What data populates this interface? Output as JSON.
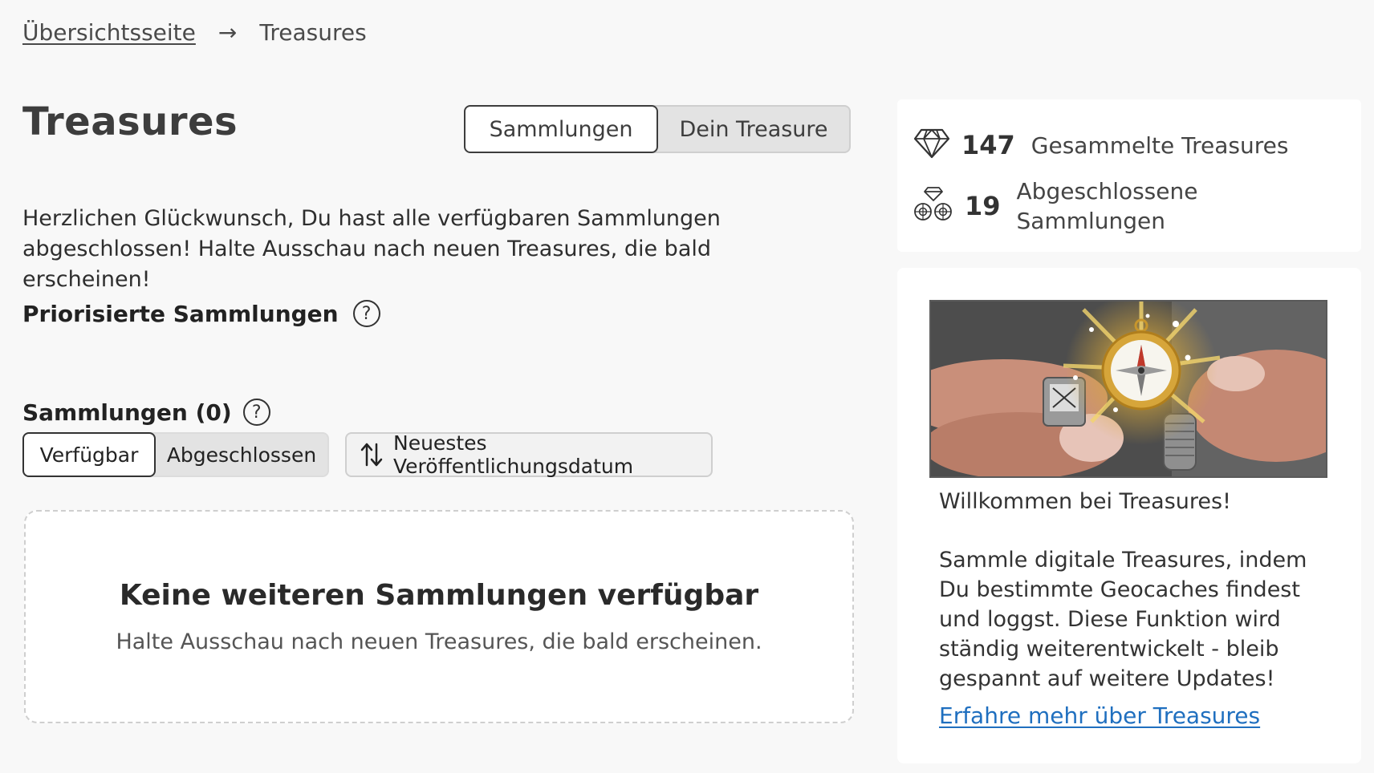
{
  "breadcrumb": {
    "home": "Übersichtsseite",
    "current": "Treasures"
  },
  "page": {
    "title": "Treasures"
  },
  "view_toggle": {
    "active": "Sammlungen",
    "inactive": "Dein Treasure"
  },
  "intro_text": "Herzlichen Glückwunsch, Du hast alle verfügbaren Sammlungen abgeschlossen! Halte Ausschau nach neuen Treasures, die bald erscheinen!",
  "prioritized": {
    "heading": "Priorisierte Sammlungen"
  },
  "collections": {
    "heading": "Sammlungen (0)",
    "filter_active": "Verfügbar",
    "filter_inactive": "Abgeschlossen",
    "sort_label": "Neuestes Veröffentlichungsdatum"
  },
  "empty_state": {
    "title": "Keine weiteren Sammlungen verfügbar",
    "subtitle": "Halte Ausschau nach neuen Treasures, die bald erscheinen."
  },
  "stats": {
    "collected": {
      "value": "147",
      "label": "Gesammelte Treasures",
      "icon": "diamond-icon"
    },
    "completed": {
      "value": "19",
      "label_line1": "Abgeschlossene",
      "label_line2": "Sammlungen",
      "icon": "gems-icon"
    }
  },
  "info": {
    "welcome": "Willkommen bei Treasures!",
    "text": "Sammle digitale Treasures, indem Du bestimmte Geocaches findest und loggst. Diese Funktion wird ständig weiterentwickelt - bleib gespannt auf weitere Updates!",
    "link": "Erfahre mehr über Treasures"
  },
  "colors": {
    "link": "#1f6fbf",
    "text": "#333333",
    "background": "#f8f8f8"
  }
}
